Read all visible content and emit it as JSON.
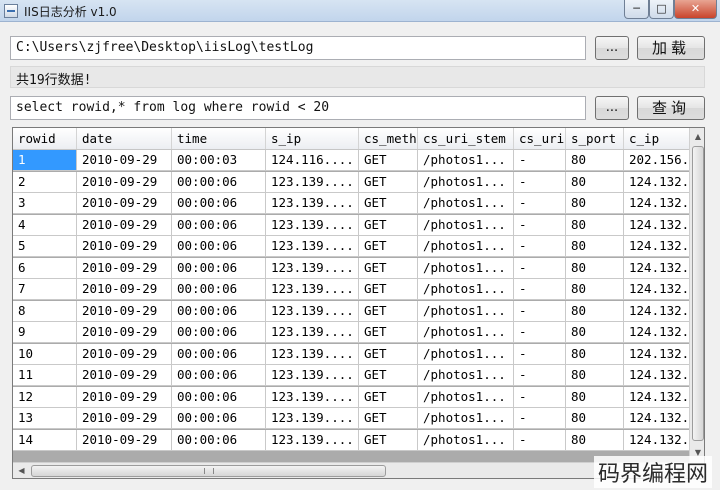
{
  "window": {
    "title": "IIS日志分析 v1.0",
    "controls": {
      "minimize": "─",
      "maximize": "□",
      "close": "✕"
    }
  },
  "path_row": {
    "path_value": "C:\\Users\\zjfree\\Desktop\\iisLog\\testLog",
    "browse_label": "...",
    "load_label": "加载"
  },
  "status": {
    "text": "共19行数据!"
  },
  "query_row": {
    "query_value": "select rowid,* from log where rowid < 20",
    "browse_label": "...",
    "query_label": "查询"
  },
  "grid": {
    "columns": [
      "rowid",
      "date",
      "time",
      "s_ip",
      "cs_meth",
      "cs_uri_stem",
      "cs_uri",
      "s_port",
      "c_ip"
    ],
    "rows": [
      [
        "1",
        "2010-09-29",
        "00:00:03",
        "124.116....",
        "GET",
        "/photos1...",
        "-",
        "80",
        "202.156..."
      ],
      [
        "2",
        "2010-09-29",
        "00:00:06",
        "123.139....",
        "GET",
        "/photos1...",
        "-",
        "80",
        "124.132..."
      ],
      [
        "3",
        "2010-09-29",
        "00:00:06",
        "123.139....",
        "GET",
        "/photos1...",
        "-",
        "80",
        "124.132..."
      ],
      [
        "4",
        "2010-09-29",
        "00:00:06",
        "123.139....",
        "GET",
        "/photos1...",
        "-",
        "80",
        "124.132..."
      ],
      [
        "5",
        "2010-09-29",
        "00:00:06",
        "123.139....",
        "GET",
        "/photos1...",
        "-",
        "80",
        "124.132..."
      ],
      [
        "6",
        "2010-09-29",
        "00:00:06",
        "123.139....",
        "GET",
        "/photos1...",
        "-",
        "80",
        "124.132..."
      ],
      [
        "7",
        "2010-09-29",
        "00:00:06",
        "123.139....",
        "GET",
        "/photos1...",
        "-",
        "80",
        "124.132..."
      ],
      [
        "8",
        "2010-09-29",
        "00:00:06",
        "123.139....",
        "GET",
        "/photos1...",
        "-",
        "80",
        "124.132..."
      ],
      [
        "9",
        "2010-09-29",
        "00:00:06",
        "123.139....",
        "GET",
        "/photos1...",
        "-",
        "80",
        "124.132..."
      ],
      [
        "10",
        "2010-09-29",
        "00:00:06",
        "123.139....",
        "GET",
        "/photos1...",
        "-",
        "80",
        "124.132..."
      ],
      [
        "11",
        "2010-09-29",
        "00:00:06",
        "123.139....",
        "GET",
        "/photos1...",
        "-",
        "80",
        "124.132..."
      ],
      [
        "12",
        "2010-09-29",
        "00:00:06",
        "123.139....",
        "GET",
        "/photos1...",
        "-",
        "80",
        "124.132..."
      ],
      [
        "13",
        "2010-09-29",
        "00:00:06",
        "123.139....",
        "GET",
        "/photos1...",
        "-",
        "80",
        "124.132..."
      ],
      [
        "14",
        "2010-09-29",
        "00:00:06",
        "123.139....",
        "GET",
        "/photos1...",
        "-",
        "80",
        "124.132..."
      ]
    ],
    "selected_row": 0,
    "selected_col": 0
  },
  "watermark": "码界编程网",
  "icons": {
    "app": "app-window-icon",
    "scroll_up": "scroll-up-arrow-icon",
    "scroll_down": "scroll-down-arrow-icon",
    "scroll_left": "scroll-left-arrow-icon",
    "scroll_right": "scroll-right-arrow-icon"
  },
  "colors": {
    "selection": "#3399ff",
    "titlebar": "#c2d5ec",
    "close_button": "#c9442b",
    "window_bg": "#f0f0f0"
  }
}
